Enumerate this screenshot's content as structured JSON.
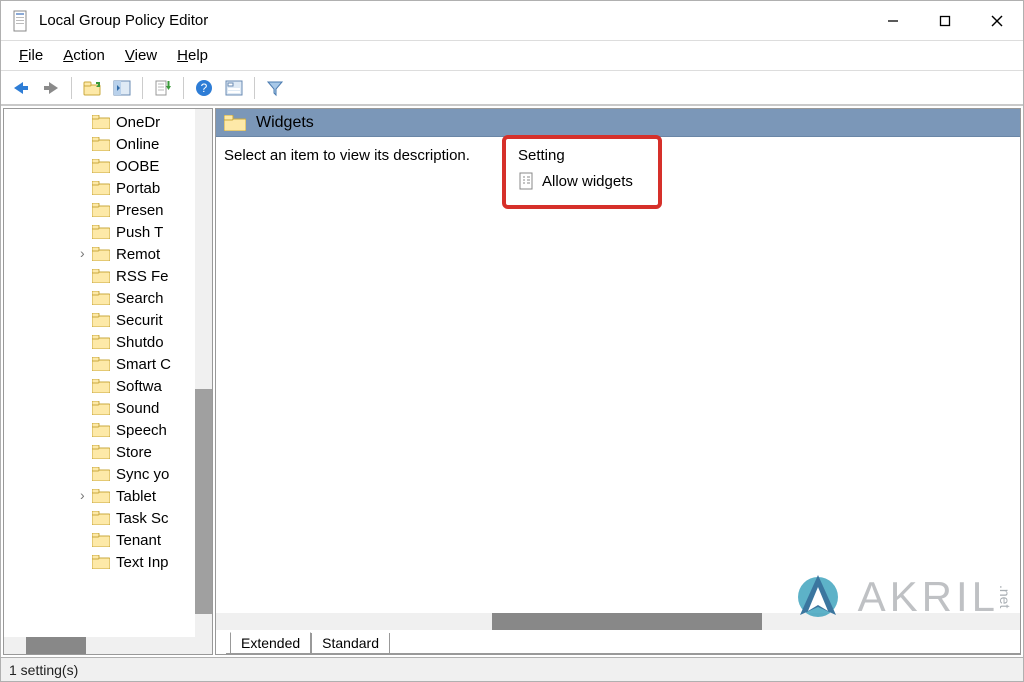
{
  "title": "Local Group Policy Editor",
  "menubar": {
    "file": "File",
    "action": "Action",
    "view": "View",
    "help": "Help"
  },
  "tree": {
    "items": [
      "OneDr",
      "Online",
      "OOBE",
      "Portab",
      "Presen",
      "Push T",
      "Remot",
      "RSS Fe",
      "Search",
      "Securit",
      "Shutdo",
      "Smart C",
      "Softwa",
      "Sound",
      "Speech",
      "Store",
      "Sync yo",
      "Tablet",
      "Task Sc",
      "Tenant",
      "Text Inp"
    ]
  },
  "detail": {
    "header": "Widgets",
    "description": "Select an item to view its description.",
    "column_header": "Setting",
    "rows": [
      "Allow widgets"
    ]
  },
  "tabs": {
    "extended": "Extended",
    "standard": "Standard"
  },
  "status": "1 setting(s)",
  "watermark": {
    "text": "AKRIL",
    "suffix": ".net"
  }
}
